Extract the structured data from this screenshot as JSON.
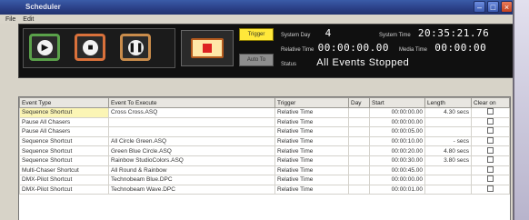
{
  "window": {
    "title": "Scheduler"
  },
  "menu": {
    "file": "File",
    "edit": "Edit"
  },
  "transport": {
    "play_icon": "play-icon",
    "stop_icon": "stop-icon",
    "pause_icon": "pause-icon",
    "record_icon": "record-icon"
  },
  "buttons": {
    "trigger": "Trigger",
    "autoto": "Auto To"
  },
  "status": {
    "system_day_label": "System Day",
    "system_day_value": "4",
    "relative_time_label": "Relative Time",
    "relative_time_value": "00:00:00.00",
    "system_time_label": "System Time",
    "system_time_value": "20:35:21.76",
    "media_time_label": "Media Time",
    "media_time_value": "00:00:00",
    "status_label": "Status",
    "status_value": "All Events Stopped"
  },
  "table": {
    "columns": [
      "Event Type",
      "Event To Execute",
      "Trigger",
      "Day",
      "Start",
      "Length",
      "Clear on"
    ],
    "rows": [
      [
        "Sequence Shortcut",
        "Cross Cross.ASQ",
        "Relative Time",
        "",
        "00:00:00.00",
        "4.30  secs",
        ""
      ],
      [
        "Pause All Chasers",
        "",
        "Relative Time",
        "",
        "00:00:00.00",
        "",
        ""
      ],
      [
        "Pause All Chasers",
        "",
        "Relative Time",
        "",
        "00:00:05.00",
        "",
        ""
      ],
      [
        "Sequence Shortcut",
        "All Circle Green.ASQ",
        "Relative Time",
        "",
        "00:00:10.00",
        "-  secs",
        ""
      ],
      [
        "Sequence Shortcut",
        "Green Blue Circle.ASQ",
        "Relative Time",
        "",
        "00:00:20.00",
        "4.80  secs",
        ""
      ],
      [
        "Sequence Shortcut",
        "Rainbow StudioColors.ASQ",
        "Relative Time",
        "",
        "00:00:30.00",
        "3.80  secs",
        ""
      ],
      [
        "Multi-Chaser Shortcut",
        "All Round & Rainbow",
        "Relative Time",
        "",
        "00:00:45.00",
        "",
        ""
      ],
      [
        "DMX-Pilot Shortcut",
        "Technobeam Blue.DPC",
        "Relative Time",
        "",
        "00:00:00.00",
        "",
        ""
      ],
      [
        "DMX-Pilot Shortcut",
        "Technobeam Wave.DPC",
        "Relative Time",
        "",
        "00:00:01.00",
        "",
        ""
      ]
    ]
  }
}
